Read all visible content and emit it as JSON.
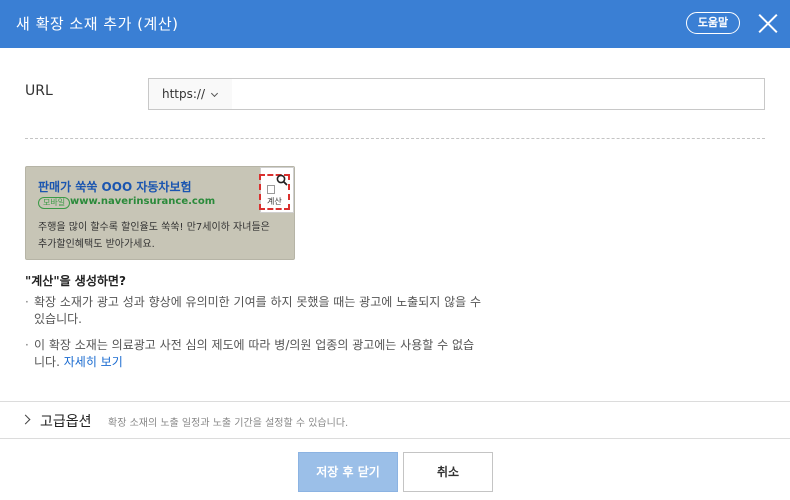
{
  "dialog": {
    "title": "새 확장 소재 추가 (계산)",
    "help_label": "도움말",
    "close_icon": "close-icon"
  },
  "url_field": {
    "label": "URL",
    "protocol_selected": "https://",
    "value": "",
    "placeholder": ""
  },
  "preview": {
    "title": "판매가 쑥쑥 OOO 자동차보험",
    "mobile_badge": "모바일",
    "display_url": "www.naverinsurance.com",
    "desc_line1": "주행을 많이 할수록 할인율도 쑥쑥! 만7세이하 자녀들은",
    "desc_line2": "추가할인혜택도 받아가세요.",
    "calc_label": "계산",
    "search_icon": "search-icon"
  },
  "info": {
    "title": "\"계산\"을 생성하면?",
    "bullet1": "확장 소재가 광고 성과 향상에 유의미한 기여를 하지 못했을 때는 광고에 노출되지 않을 수 있습니다.",
    "bullet2": "이 확장 소재는 의료광고 사전 심의 제도에 따라 병/의원 업종의 광고에는 사용할 수 없습니다.",
    "more_link": "자세히 보기"
  },
  "advanced": {
    "title": "고급옵션",
    "description": "확장 소재의 노출 일정과 노출 기간을 설정할 수 있습니다."
  },
  "footer": {
    "save_label": "저장 후 닫기",
    "cancel_label": "취소"
  },
  "colors": {
    "header_bg": "#3a7fd4",
    "save_button_bg": "#9bbfe8",
    "link": "#1a6bd0",
    "preview_bg": "#c7c5b6"
  }
}
